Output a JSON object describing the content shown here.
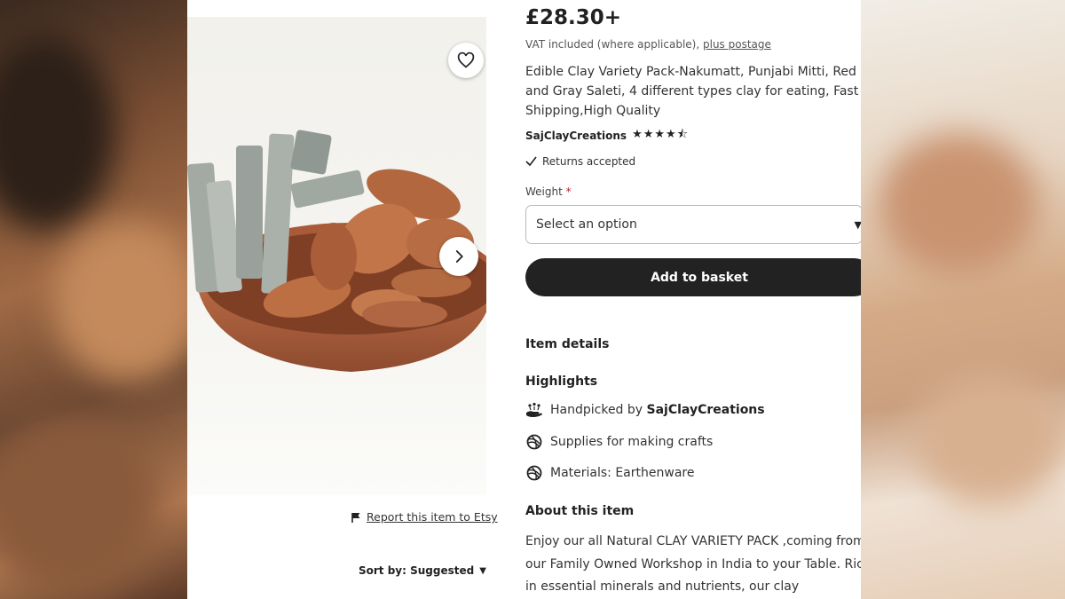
{
  "listing": {
    "price": "£28.30+",
    "vat_text": "VAT included (where applicable),",
    "postage_link": "plus postage",
    "title": "Edible Clay Variety Pack-Nakumatt, Punjabi Mitti, Red and Gray Saleti, 4 different types clay for eating, Fast Shipping,High Quality",
    "shop_name": "SajClayCreations",
    "rating_stars": "★★★★⯪",
    "returns_text": "Returns accepted"
  },
  "options": {
    "weight_label": "Weight",
    "required_mark": "*",
    "select_value": "Select an option"
  },
  "actions": {
    "add_to_basket": "Add to basket",
    "report_link": "Report this item to Etsy",
    "sort_label": "Sort by: Suggested"
  },
  "details": {
    "item_details": "Item details",
    "highlights_heading": "Highlights",
    "highlights": [
      {
        "text": "Handpicked by",
        "bold": "SajClayCreations",
        "icon": "hand-icon"
      },
      {
        "text": "Supplies for making crafts",
        "icon": "yarn-ball-icon"
      },
      {
        "text": "Materials: Earthenware",
        "icon": "yarn-ball-icon"
      }
    ],
    "about_heading": "About this item",
    "about_text": "Enjoy our all Natural CLAY VARIETY PACK ,coming from our Family Owned Workshop in India to your Table. Rich in essential minerals and nutrients, our clay"
  }
}
